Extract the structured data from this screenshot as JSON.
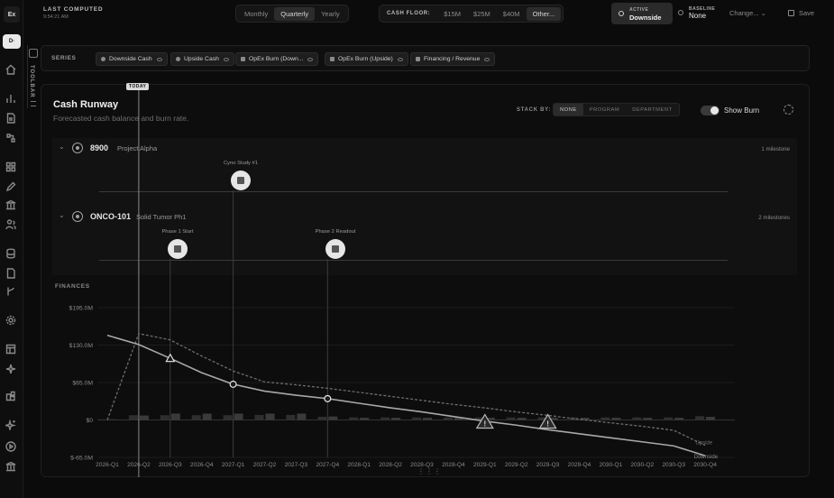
{
  "topbar": {
    "last_computed_label": "LAST COMPUTED",
    "last_computed_time": "9:54:21 AM",
    "period_options": [
      "Monthly",
      "Quarterly",
      "Yearly"
    ],
    "period_selected": "Quarterly",
    "cash_floor_label": "CASH FLOOR:",
    "cash_floor_options": [
      "$15M",
      "$25M",
      "$40M",
      "Other..."
    ],
    "cash_floor_selected": "Other...",
    "active_label": "ACTIVE",
    "active_value": "Downside",
    "baseline_label": "BASELINE",
    "baseline_value": "None",
    "change_label": "Change...",
    "save_label": "Save"
  },
  "toolbar": {
    "label": "TOOLBAR"
  },
  "series": {
    "label": "SERIES",
    "chips": [
      "Downside Cash",
      "Upside Cash",
      "OpEx Burn (Down...",
      "OpEx Burn (Upside)",
      "Financing / Revenue"
    ]
  },
  "card": {
    "title": "Cash Runway",
    "subtitle": "Forecasted cash balance and burn rate.",
    "stack_by_label": "STACK BY:",
    "stack_by_options": [
      "NONE",
      "PROGRAM",
      "DEPARTMENT"
    ],
    "stack_by_selected": "NONE",
    "show_burn_label": "Show Burn",
    "today_label": "TODAY",
    "finances_label": "FINANCES"
  },
  "programs": [
    {
      "id": "8900",
      "name": "Project Alpha",
      "milestone_count": "1 milestone",
      "milestones": [
        {
          "label": "Cyno Study #1",
          "quarter": "2027-Q1"
        }
      ]
    },
    {
      "id": "ONCO-101",
      "name": "Solid Tumor Ph1",
      "milestone_count": "2 milestones",
      "milestones": [
        {
          "label": "Phase 1 Start",
          "quarter": "2026-Q3"
        },
        {
          "label": "Phase 2 Readout",
          "quarter": "2027-Q4"
        }
      ]
    }
  ],
  "chart_data": {
    "type": "line",
    "x": [
      "2026-Q1",
      "2026-Q2",
      "2026-Q3",
      "2026-Q4",
      "2027-Q1",
      "2027-Q2",
      "2027-Q3",
      "2027-Q4",
      "2028-Q1",
      "2028-Q2",
      "2028-Q3",
      "2028-Q4",
      "2029-Q1",
      "2029-Q2",
      "2029-Q3",
      "2029-Q4",
      "2030-Q1",
      "2030-Q2",
      "2030-Q3",
      "2030-Q4"
    ],
    "yticks": [
      "$195.0M",
      "$130.0M",
      "$65.0M",
      "$0",
      "$-65.0M"
    ],
    "ylim": [
      -65,
      195
    ],
    "today": "2026-Q2",
    "series": [
      {
        "name": "Downside",
        "style": "solid",
        "values": [
          147,
          131,
          107,
          82,
          62,
          50,
          43,
          37,
          29,
          21,
          14,
          6,
          -2,
          -9,
          -17,
          -24,
          -31,
          -38,
          -45,
          -62
        ]
      },
      {
        "name": "Upside",
        "style": "dashed",
        "values": [
          0,
          150,
          139,
          111,
          85,
          66,
          61,
          55,
          48,
          41,
          34,
          27,
          21,
          14,
          8,
          1,
          -5,
          -11,
          -18,
          -44
        ]
      },
      {
        "name": "OpEx Burn (Downside)",
        "style": "bars",
        "values": [
          2,
          15,
          15,
          15,
          15,
          16,
          16,
          10,
          8,
          8,
          8,
          8,
          8,
          8,
          8,
          8,
          8,
          8,
          8,
          12
        ]
      },
      {
        "name": "OpEx Burn (Upside)",
        "style": "bars",
        "values": [
          2,
          14,
          20,
          20,
          20,
          20,
          20,
          11,
          7,
          7,
          7,
          7,
          7,
          7,
          7,
          7,
          7,
          7,
          7,
          10
        ]
      }
    ],
    "warnings": [
      "2029-Q1",
      "2029-Q3"
    ],
    "milestone_markers": [
      {
        "quarter": "2026-Q3",
        "shape": "triangle"
      },
      {
        "quarter": "2027-Q1",
        "shape": "circle"
      },
      {
        "quarter": "2027-Q4",
        "shape": "circle"
      }
    ]
  }
}
